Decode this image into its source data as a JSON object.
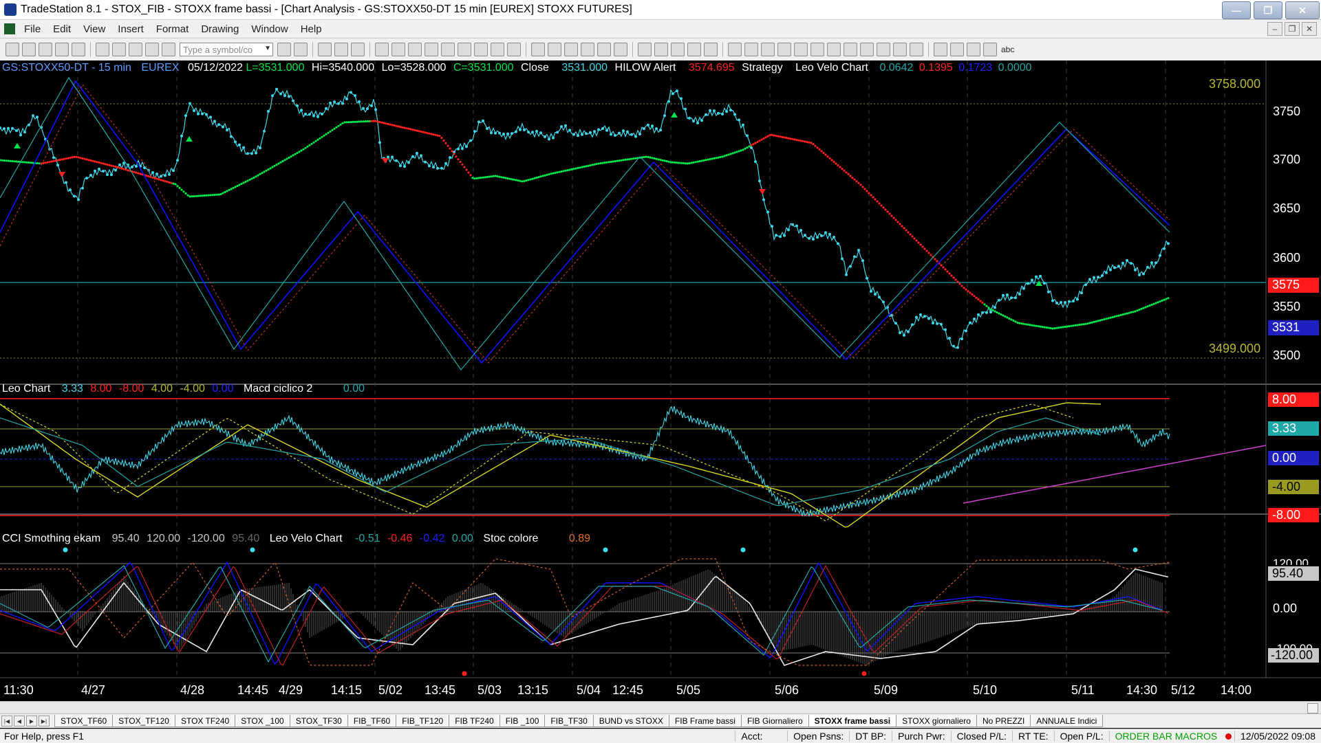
{
  "window": {
    "title": "TradeStation 8.1 - STOX_FIB - STOXX frame bassi - [Chart Analysis - GS:STOXX50-DT  15 min  [EUREX] STOXX FUTURES]"
  },
  "menu": [
    "File",
    "Edit",
    "View",
    "Insert",
    "Format",
    "Drawing",
    "Window",
    "Help"
  ],
  "toolbar": {
    "symbol_placeholder": "Type a symbol/co",
    "abc_label": "abc"
  },
  "price_header": {
    "symbol": "GS:STOXX50-DT - 15 min",
    "exchange": "EUREX",
    "date": "05/12/2022",
    "last": "L=3531.000",
    "high": "Hi=3540.000",
    "low": "Lo=3528.000",
    "close_c": "C=3531.000",
    "close_label": "Close",
    "close_value": "3531.000",
    "hilow_label": "HILOW Alert",
    "hilow_value": "3574.695",
    "strategy_label": "Strategy",
    "leo_velo_label": "Leo Velo Chart",
    "v1": "0.0642",
    "v2": "0.1395",
    "v3": "0.1723",
    "v4": "0.0000"
  },
  "price_axis": {
    "ticks": [
      "3750",
      "3700",
      "3650",
      "3600",
      "3550",
      "3500"
    ],
    "level_high": "3758.000",
    "level_low": "3499.000",
    "badge_red": "3575",
    "badge_blue": "3531"
  },
  "leo_header": {
    "label": "Leo Chart",
    "v1": "3.33",
    "v2": "8.00",
    "v3": "-8.00",
    "v4": "4.00",
    "v5": "-4.00",
    "v6": "0.00",
    "macd_label": "Macd ciclico 2",
    "macd_value": "0.00"
  },
  "leo_axis": {
    "b1": "8.00",
    "b2": "3.33",
    "b3": "0.00",
    "b4": "-4.00",
    "b5": "-8.00"
  },
  "cci_header": {
    "label": "CCI Smothing ekam",
    "v1": "95.40",
    "v2": "120.00",
    "v3": "-120.00",
    "v4": "95.40",
    "velo_label": "Leo Velo Chart",
    "velo1": "-0.51",
    "velo2": "-0.46",
    "velo3": "-0.42",
    "velo4": "0.00",
    "stoc_label": "Stoc colore",
    "stoc_value": "0.89"
  },
  "cci_axis": {
    "top": "120.00",
    "val": "95.40",
    "zero": "0.00",
    "mid": "-100.00",
    "bottom": "-120.00"
  },
  "time_axis": [
    "11:30",
    "4/27",
    "4/28",
    "14:45",
    "4/29",
    "14:15",
    "5/02",
    "13:45",
    "5/03",
    "13:15",
    "5/04",
    "12:45",
    "5/05",
    "5/06",
    "5/09",
    "5/10",
    "5/11",
    "14:30",
    "5/12",
    "14:00"
  ],
  "tabs": [
    "STOX_TF60",
    "STOX_TF120",
    "STOX TF240",
    "STOX _100",
    "STOX_TF30",
    "FIB_TF60",
    "FIB_TF120",
    "FIB TF240",
    "FIB _100",
    "FIB_TF30",
    "BUND vs STOXX",
    "FIB Frame bassi",
    "FIB Giornaliero",
    "STOXX frame bassi",
    "STOXX giornaliero",
    "No PREZZI",
    "ANNUALE Indici"
  ],
  "active_tab": "STOXX frame bassi",
  "status": {
    "help": "For Help, press F1",
    "acct": "Acct:",
    "open_psns": "Open Psns:",
    "dt_bp": "DT BP:",
    "purch_pwr": "Purch Pwr:",
    "closed_pl": "Closed P/L:",
    "rt_te": "RT TE:",
    "open_pl": "Open P/L:",
    "macros": "ORDER BAR  MACROS",
    "datetime": "12/05/2022 09:08"
  },
  "colors": {
    "price_line": "#3fd6e8",
    "up_avg": "#00e64a",
    "down_avg": "#ff2020",
    "yellow": "#d8d820",
    "magenta": "#d040d0",
    "blue_line": "#1010ff",
    "teal_line": "#20a8a8"
  }
}
